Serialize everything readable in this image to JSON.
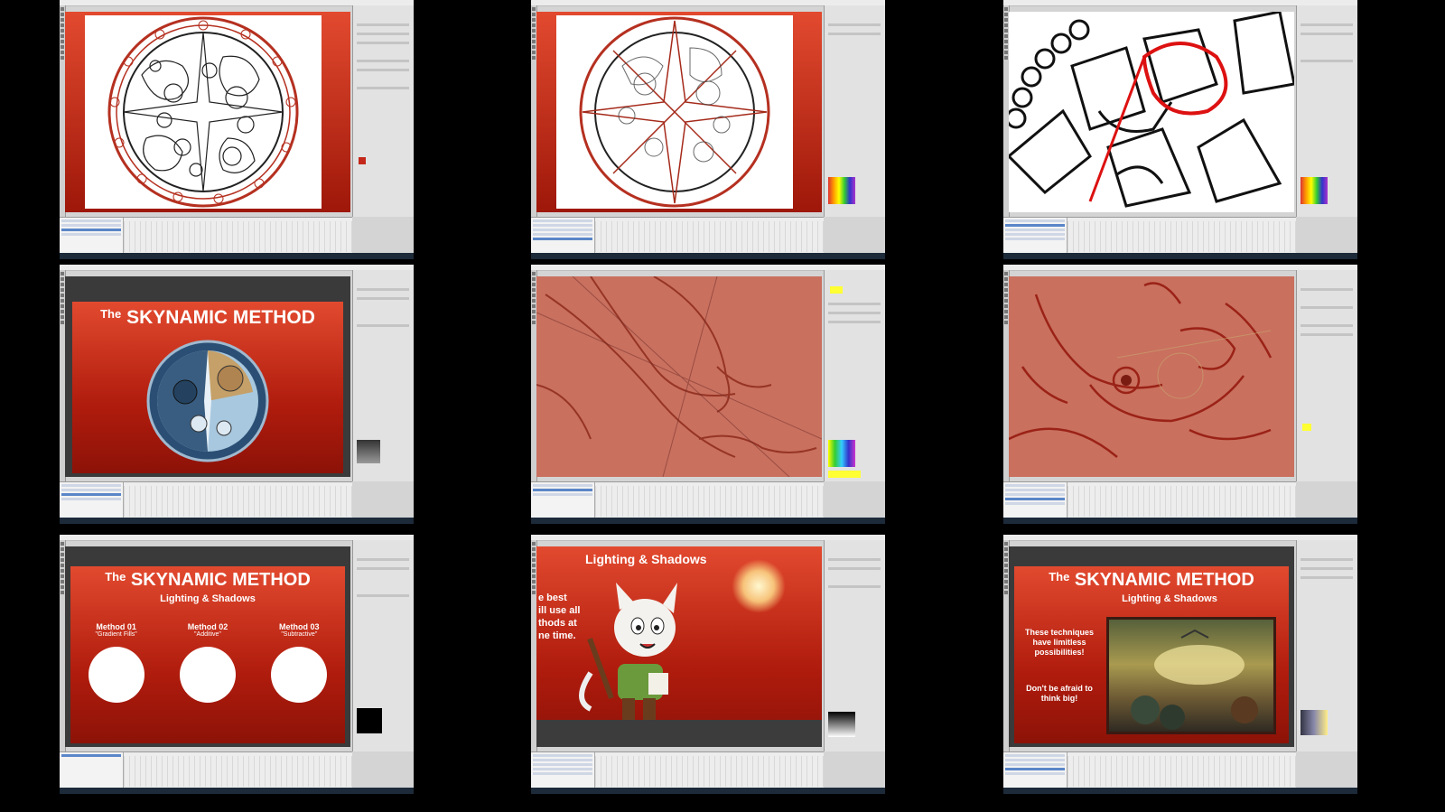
{
  "grid": {
    "cells": [
      {
        "id": "c1",
        "desc": "stained-glass lineart"
      },
      {
        "id": "c2",
        "desc": "stained-glass lineart with guides"
      },
      {
        "id": "c3",
        "desc": "zoomed lineart dragon"
      },
      {
        "id": "c4",
        "desc": "title slide"
      },
      {
        "id": "c5",
        "desc": "sketch closeup"
      },
      {
        "id": "c6",
        "desc": "sketch face closeup"
      },
      {
        "id": "c7",
        "desc": "methods slide"
      },
      {
        "id": "c8",
        "desc": "cat character slide"
      },
      {
        "id": "c9",
        "desc": "big ideas slide"
      }
    ]
  },
  "slides": {
    "title_prefix": "The",
    "title_main": "SKYNAMIC METHOD",
    "subtitle": "Lighting & Shadows",
    "methods": [
      {
        "label": "Method 01",
        "sub": "\"Gradient Fills\""
      },
      {
        "label": "Method 02",
        "sub": "\"Additive\""
      },
      {
        "label": "Method 03",
        "sub": "\"Subtractive\""
      }
    ],
    "cat_slide_title": "Lighting & Shadows",
    "cat_slide_text": [
      "e best",
      "ill use all",
      "thods at",
      "ne time."
    ],
    "big_text_1": "These techniques have limitless possibilities!",
    "big_text_2": "Don't be afraid to think big!"
  },
  "colors": {
    "accent_red": "#c4281a",
    "sketch_bg": "#c9705f",
    "panel_bg": "#e2e2e2"
  }
}
